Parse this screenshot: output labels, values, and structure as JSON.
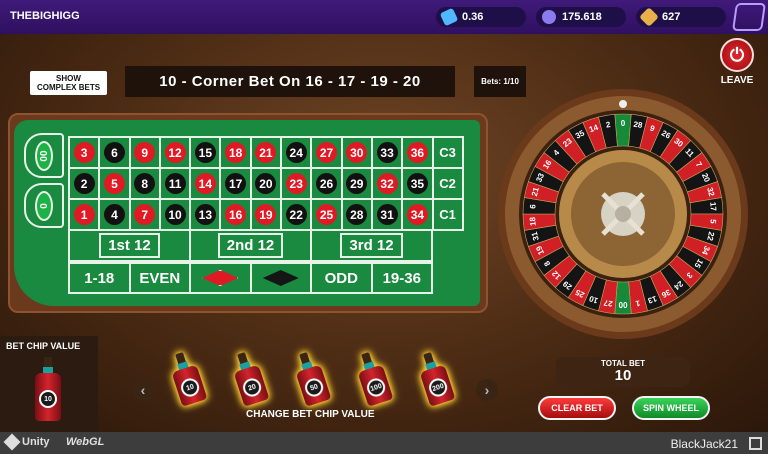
{
  "topbar": {
    "username": "THEBIGHIGG",
    "stats": [
      {
        "icon": "diamond-ticket-icon",
        "value": "0.36"
      },
      {
        "icon": "coins-icon",
        "value": "175.618"
      },
      {
        "icon": "gem-icon",
        "value": "627"
      }
    ],
    "logo": "game-logo"
  },
  "controls": {
    "show_complex_line1": "SHOW",
    "show_complex_line2": "COMPLEX BETS",
    "current_bet": "10 -  Corner Bet On 16 - 17 - 19 - 20",
    "bets_count": "Bets: 1/10",
    "leave_label": "LEAVE"
  },
  "table": {
    "zeros": [
      "00",
      "0"
    ],
    "rows": [
      [
        {
          "n": "3",
          "c": "red"
        },
        {
          "n": "6",
          "c": "black"
        },
        {
          "n": "9",
          "c": "red"
        },
        {
          "n": "12",
          "c": "red"
        },
        {
          "n": "15",
          "c": "black"
        },
        {
          "n": "18",
          "c": "red"
        },
        {
          "n": "21",
          "c": "red"
        },
        {
          "n": "24",
          "c": "black"
        },
        {
          "n": "27",
          "c": "red"
        },
        {
          "n": "30",
          "c": "red"
        },
        {
          "n": "33",
          "c": "black"
        },
        {
          "n": "36",
          "c": "red"
        }
      ],
      [
        {
          "n": "2",
          "c": "black"
        },
        {
          "n": "5",
          "c": "red"
        },
        {
          "n": "8",
          "c": "black"
        },
        {
          "n": "11",
          "c": "black"
        },
        {
          "n": "14",
          "c": "red"
        },
        {
          "n": "17",
          "c": "black"
        },
        {
          "n": "20",
          "c": "black"
        },
        {
          "n": "23",
          "c": "red"
        },
        {
          "n": "26",
          "c": "black"
        },
        {
          "n": "29",
          "c": "black"
        },
        {
          "n": "32",
          "c": "red"
        },
        {
          "n": "35",
          "c": "black"
        }
      ],
      [
        {
          "n": "1",
          "c": "red"
        },
        {
          "n": "4",
          "c": "black"
        },
        {
          "n": "7",
          "c": "red"
        },
        {
          "n": "10",
          "c": "black"
        },
        {
          "n": "13",
          "c": "black"
        },
        {
          "n": "16",
          "c": "red"
        },
        {
          "n": "19",
          "c": "red"
        },
        {
          "n": "22",
          "c": "black"
        },
        {
          "n": "25",
          "c": "red"
        },
        {
          "n": "28",
          "c": "black"
        },
        {
          "n": "31",
          "c": "black"
        },
        {
          "n": "34",
          "c": "red"
        }
      ]
    ],
    "columns": [
      "C3",
      "C2",
      "C1"
    ],
    "dozens": [
      "1st 12",
      "2nd 12",
      "3rd 12"
    ],
    "outside": [
      "1-18",
      "EVEN",
      "",
      "",
      "ODD",
      "19-36"
    ],
    "colors": {
      "red": "#e01a24",
      "black": "#111111"
    }
  },
  "wheel": {
    "numbers": [
      "0",
      "28",
      "9",
      "26",
      "30",
      "11",
      "7",
      "20",
      "32",
      "17",
      "5",
      "22",
      "34",
      "15",
      "3",
      "24",
      "36",
      "13",
      "1",
      "00",
      "27",
      "10",
      "25",
      "29",
      "12",
      "8",
      "19",
      "31",
      "18",
      "6",
      "21",
      "33",
      "16",
      "4",
      "23",
      "35",
      "14",
      "2"
    ],
    "colors": [
      "green",
      "black",
      "red",
      "black",
      "red",
      "black",
      "red",
      "black",
      "red",
      "black",
      "red",
      "black",
      "red",
      "black",
      "red",
      "black",
      "red",
      "black",
      "red",
      "green",
      "red",
      "black",
      "red",
      "black",
      "red",
      "black",
      "red",
      "black",
      "red",
      "black",
      "red",
      "black",
      "red",
      "black",
      "red",
      "black",
      "red",
      "black"
    ]
  },
  "chips": {
    "panel_title": "BET CHIP VALUE",
    "selected_value": "10",
    "options": [
      "10",
      "20",
      "50",
      "100",
      "200"
    ],
    "change_label": "CHANGE BET CHIP VALUE"
  },
  "totals": {
    "total_label": "TOTAL BET",
    "total_value": "10",
    "clear_label": "CLEAR BET",
    "spin_label": "SPIN WHEEL"
  },
  "footer": {
    "unity_label": "Unity",
    "webgl_label": "WebGL",
    "game_name": "BlackJack21"
  }
}
